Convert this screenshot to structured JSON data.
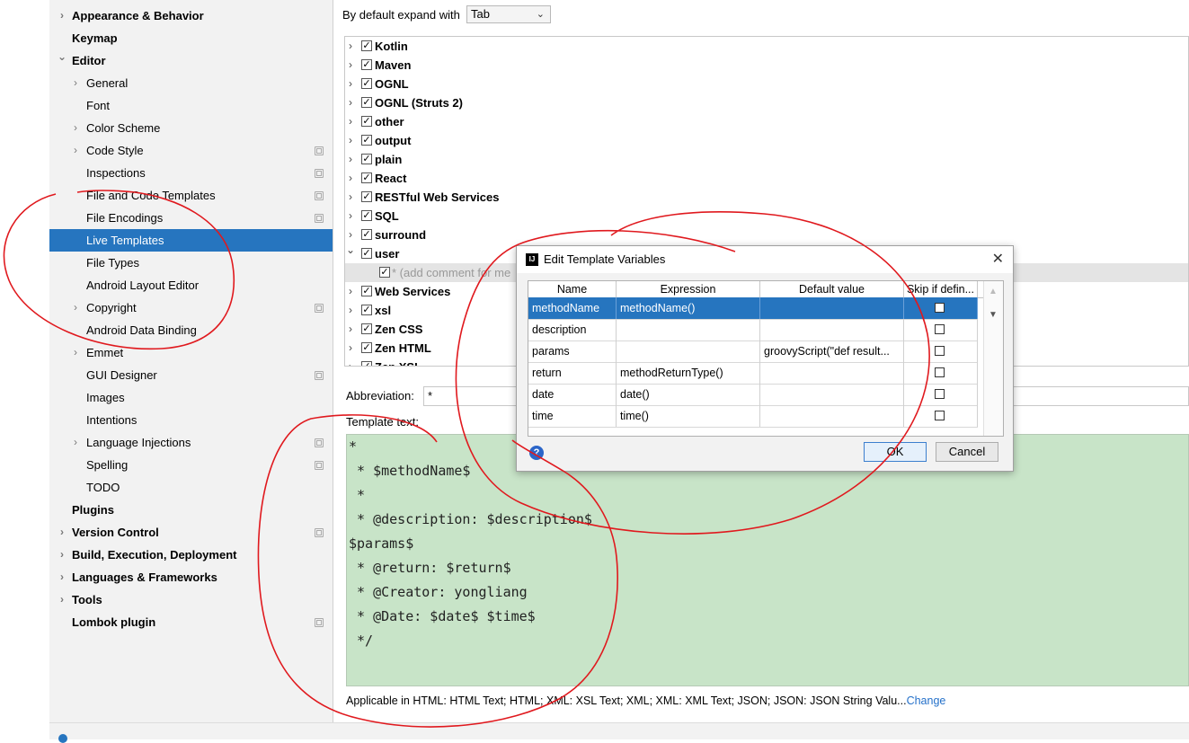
{
  "sidebar": {
    "items": [
      {
        "label": "Appearance & Behavior",
        "level": 0,
        "bold": true,
        "chevron": "right",
        "config": false,
        "selected": false
      },
      {
        "label": "Keymap",
        "level": 0,
        "bold": true,
        "chevron": "",
        "config": false,
        "selected": false
      },
      {
        "label": "Editor",
        "level": 0,
        "bold": true,
        "chevron": "down",
        "config": false,
        "selected": false
      },
      {
        "label": "General",
        "level": 1,
        "bold": false,
        "chevron": "right",
        "config": false,
        "selected": false
      },
      {
        "label": "Font",
        "level": 1,
        "bold": false,
        "chevron": "",
        "config": false,
        "selected": false
      },
      {
        "label": "Color Scheme",
        "level": 1,
        "bold": false,
        "chevron": "right",
        "config": false,
        "selected": false
      },
      {
        "label": "Code Style",
        "level": 1,
        "bold": false,
        "chevron": "right",
        "config": true,
        "selected": false
      },
      {
        "label": "Inspections",
        "level": 1,
        "bold": false,
        "chevron": "",
        "config": true,
        "selected": false
      },
      {
        "label": "File and Code Templates",
        "level": 1,
        "bold": false,
        "chevron": "",
        "config": true,
        "selected": false
      },
      {
        "label": "File Encodings",
        "level": 1,
        "bold": false,
        "chevron": "",
        "config": true,
        "selected": false
      },
      {
        "label": "Live Templates",
        "level": 1,
        "bold": false,
        "chevron": "",
        "config": false,
        "selected": true
      },
      {
        "label": "File Types",
        "level": 1,
        "bold": false,
        "chevron": "",
        "config": false,
        "selected": false
      },
      {
        "label": "Android Layout Editor",
        "level": 1,
        "bold": false,
        "chevron": "",
        "config": false,
        "selected": false
      },
      {
        "label": "Copyright",
        "level": 1,
        "bold": false,
        "chevron": "right",
        "config": true,
        "selected": false
      },
      {
        "label": "Android Data Binding",
        "level": 1,
        "bold": false,
        "chevron": "",
        "config": false,
        "selected": false
      },
      {
        "label": "Emmet",
        "level": 1,
        "bold": false,
        "chevron": "right",
        "config": false,
        "selected": false
      },
      {
        "label": "GUI Designer",
        "level": 1,
        "bold": false,
        "chevron": "",
        "config": true,
        "selected": false
      },
      {
        "label": "Images",
        "level": 1,
        "bold": false,
        "chevron": "",
        "config": false,
        "selected": false
      },
      {
        "label": "Intentions",
        "level": 1,
        "bold": false,
        "chevron": "",
        "config": false,
        "selected": false
      },
      {
        "label": "Language Injections",
        "level": 1,
        "bold": false,
        "chevron": "right",
        "config": true,
        "selected": false
      },
      {
        "label": "Spelling",
        "level": 1,
        "bold": false,
        "chevron": "",
        "config": true,
        "selected": false
      },
      {
        "label": "TODO",
        "level": 1,
        "bold": false,
        "chevron": "",
        "config": false,
        "selected": false
      },
      {
        "label": "Plugins",
        "level": 0,
        "bold": true,
        "chevron": "",
        "config": false,
        "selected": false
      },
      {
        "label": "Version Control",
        "level": 0,
        "bold": true,
        "chevron": "right",
        "config": true,
        "selected": false
      },
      {
        "label": "Build, Execution, Deployment",
        "level": 0,
        "bold": true,
        "chevron": "right",
        "config": false,
        "selected": false
      },
      {
        "label": "Languages & Frameworks",
        "level": 0,
        "bold": true,
        "chevron": "right",
        "config": false,
        "selected": false
      },
      {
        "label": "Tools",
        "level": 0,
        "bold": true,
        "chevron": "right",
        "config": false,
        "selected": false
      },
      {
        "label": "Lombok plugin",
        "level": 0,
        "bold": true,
        "chevron": "",
        "config": true,
        "selected": false
      }
    ]
  },
  "main": {
    "expand_label": "By default expand with",
    "expand_value": "Tab",
    "tree": [
      {
        "label": "Kotlin",
        "expanded": false,
        "checked": true
      },
      {
        "label": "Maven",
        "expanded": false,
        "checked": true
      },
      {
        "label": "OGNL",
        "expanded": false,
        "checked": true
      },
      {
        "label": "OGNL (Struts 2)",
        "expanded": false,
        "checked": true
      },
      {
        "label": "other",
        "expanded": false,
        "checked": true
      },
      {
        "label": "output",
        "expanded": false,
        "checked": true
      },
      {
        "label": "plain",
        "expanded": false,
        "checked": true
      },
      {
        "label": "React",
        "expanded": false,
        "checked": true
      },
      {
        "label": "RESTful Web Services",
        "expanded": false,
        "checked": true
      },
      {
        "label": "SQL",
        "expanded": false,
        "checked": true
      },
      {
        "label": "surround",
        "expanded": false,
        "checked": true
      },
      {
        "label": "user",
        "expanded": true,
        "checked": true
      },
      {
        "label": "* (add comment for me",
        "sub": true,
        "checked": true
      },
      {
        "label": "Web Services",
        "expanded": false,
        "checked": true
      },
      {
        "label": "xsl",
        "expanded": false,
        "checked": true
      },
      {
        "label": "Zen CSS",
        "expanded": false,
        "checked": true
      },
      {
        "label": "Zen HTML",
        "expanded": false,
        "checked": true
      },
      {
        "label": "Zen XSL",
        "expanded": false,
        "checked": true
      }
    ],
    "abbreviation_label": "Abbreviation:",
    "abbreviation_value": "*",
    "template_text_label": "Template text:",
    "template_lines": [
      "*",
      " * $methodName$",
      " *",
      " * @description: $description$",
      "$params$",
      " * @return: $return$",
      " * @Creator: yongliang",
      " * @Date: $date$ $time$",
      " */"
    ],
    "applicable_text": "Applicable in HTML: HTML Text; HTML; XML: XSL Text; XML; XML: XML Text; JSON; JSON: JSON String Valu...",
    "change_link": "Change"
  },
  "dialog": {
    "title": "Edit Template Variables",
    "logo_text": "IJ",
    "columns": [
      "Name",
      "Expression",
      "Default value",
      "Skip if defin..."
    ],
    "rows": [
      {
        "name": "methodName",
        "expression": "methodName()",
        "default": "",
        "skip": false,
        "selected": true
      },
      {
        "name": "description",
        "expression": "",
        "default": "",
        "skip": false,
        "selected": false
      },
      {
        "name": "params",
        "expression": "",
        "default": "groovyScript(\"def result...",
        "skip": false,
        "selected": false
      },
      {
        "name": "return",
        "expression": "methodReturnType()",
        "default": "",
        "skip": false,
        "selected": false
      },
      {
        "name": "date",
        "expression": "date()",
        "default": "",
        "skip": false,
        "selected": false
      },
      {
        "name": "time",
        "expression": "time()",
        "default": "",
        "skip": false,
        "selected": false
      }
    ],
    "ok_label": "OK",
    "cancel_label": "Cancel",
    "help_label": "?"
  },
  "colors": {
    "selection": "#2675bf",
    "editor_bg": "#c8e4c8",
    "annotation": "#e0191e",
    "link": "#2470c9"
  }
}
